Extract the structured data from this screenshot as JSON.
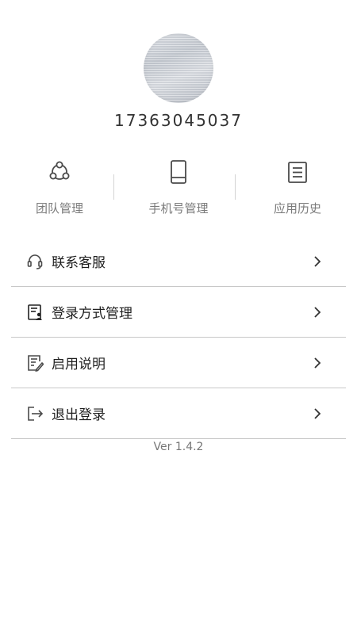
{
  "profile": {
    "phone": "17363045037"
  },
  "quick_actions": [
    {
      "label": "团队管理",
      "icon": "team-icon"
    },
    {
      "label": "手机号管理",
      "icon": "phone-icon"
    },
    {
      "label": "应用历史",
      "icon": "document-icon"
    }
  ],
  "menu": [
    {
      "label": "联系客服",
      "icon": "headset-icon"
    },
    {
      "label": "登录方式管理",
      "icon": "login-doc-user-icon"
    },
    {
      "label": "启用说明",
      "icon": "edit-doc-icon"
    },
    {
      "label": "退出登录",
      "icon": "logout-icon"
    }
  ],
  "footer": {
    "version": "Ver 1.4.2"
  },
  "colors": {
    "text_primary": "#1f1f1f",
    "text_secondary": "#7b7b7b",
    "divider": "#c8c8c8",
    "icon": "#4a4a4a"
  }
}
